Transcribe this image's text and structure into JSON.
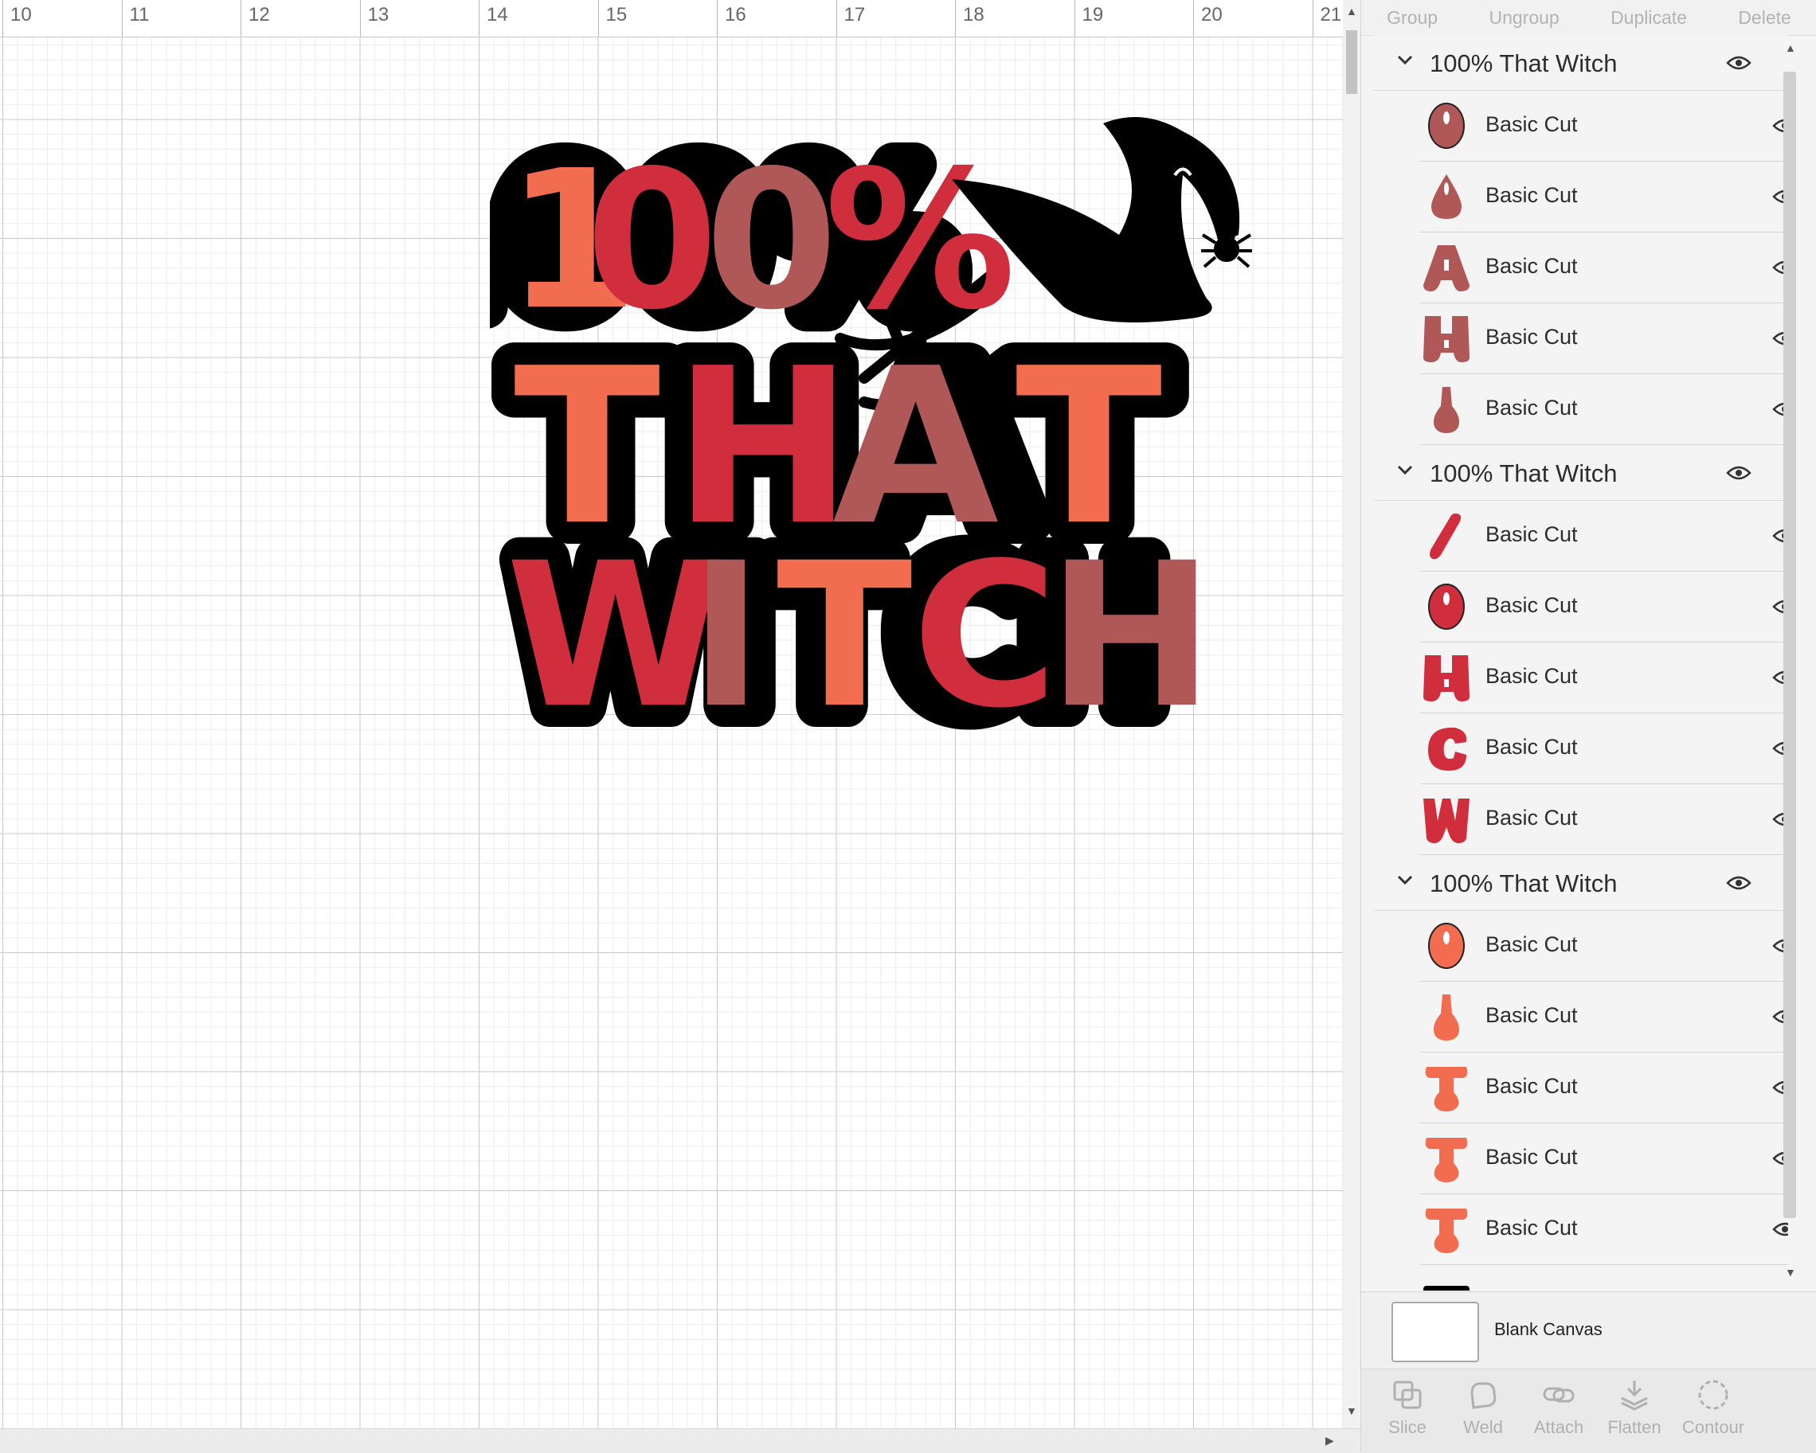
{
  "ruler": {
    "labels": [
      "10",
      "11",
      "12",
      "13",
      "14",
      "15",
      "16",
      "17",
      "18",
      "19",
      "20",
      "21"
    ]
  },
  "toolbar": {
    "group": "Group",
    "ungroup": "Ungroup",
    "duplicate": "Duplicate",
    "delete": "Delete"
  },
  "layers": {
    "groups": [
      {
        "label": "100% That Witch",
        "items": [
          {
            "label": "Basic Cut",
            "shape": "oval-hole",
            "color": "#b05858"
          },
          {
            "label": "Basic Cut",
            "shape": "drop",
            "color": "#b05858"
          },
          {
            "label": "Basic Cut",
            "shape": "letter-A",
            "color": "#b05858"
          },
          {
            "label": "Basic Cut",
            "shape": "letter-H",
            "color": "#b05858"
          },
          {
            "label": "Basic Cut",
            "shape": "stem",
            "color": "#b05858"
          }
        ]
      },
      {
        "label": "100% That Witch",
        "items": [
          {
            "label": "Basic Cut",
            "shape": "slash",
            "color": "#d02d3d"
          },
          {
            "label": "Basic Cut",
            "shape": "oval-hole",
            "color": "#d02d3d"
          },
          {
            "label": "Basic Cut",
            "shape": "letter-H",
            "color": "#d02d3d"
          },
          {
            "label": "Basic Cut",
            "shape": "letter-C",
            "color": "#d02d3d"
          },
          {
            "label": "Basic Cut",
            "shape": "letter-W",
            "color": "#d02d3d"
          }
        ]
      },
      {
        "label": "100% That Witch",
        "items": [
          {
            "label": "Basic Cut",
            "shape": "oval-hole",
            "color": "#f26d50"
          },
          {
            "label": "Basic Cut",
            "shape": "stem",
            "color": "#f26d50"
          },
          {
            "label": "Basic Cut",
            "shape": "letter-T",
            "color": "#f26d50"
          },
          {
            "label": "Basic Cut",
            "shape": "letter-T",
            "color": "#f26d50"
          },
          {
            "label": "Basic Cut",
            "shape": "letter-T",
            "color": "#f26d50"
          }
        ]
      }
    ]
  },
  "blank_canvas": {
    "label": "Blank Canvas"
  },
  "bottom_bar": {
    "slice": "Slice",
    "weld": "Weld",
    "attach": "Attach",
    "flatten": "Flatten",
    "contour": "Contour"
  },
  "colors": {
    "coral": "#f26d50",
    "red": "#d02d3d",
    "rose": "#b05858",
    "outline": "#000000"
  }
}
